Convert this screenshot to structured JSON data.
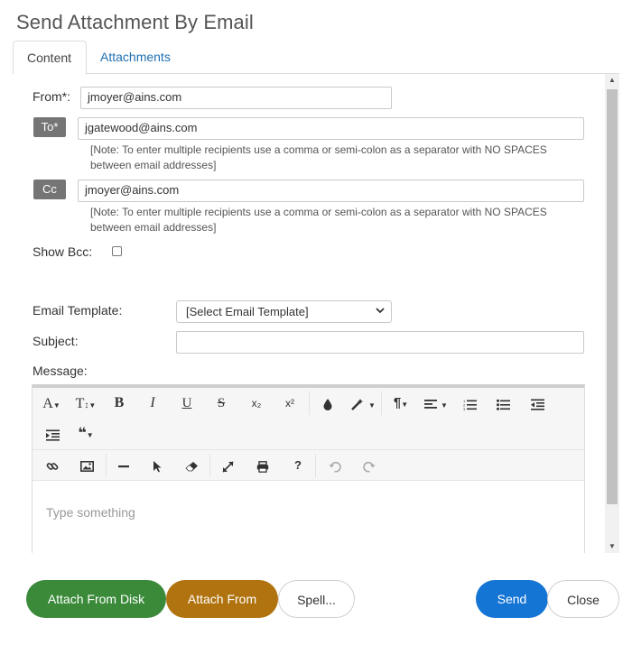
{
  "dialog": {
    "title": "Send Attachment By Email"
  },
  "tabs": [
    {
      "label": "Content"
    },
    {
      "label": "Attachments"
    }
  ],
  "form": {
    "from_label": "From*:",
    "from_value": "jmoyer@ains.com",
    "to_label": "To*",
    "to_value": "jgatewood@ains.com",
    "cc_label": "Cc",
    "cc_value": "jmoyer@ains.com",
    "note_text": "[Note: To enter multiple recipients use a comma or semi-colon as a separator with NO SPACES between email addresses]",
    "show_bcc_label": "Show Bcc:",
    "template_label": "Email Template:",
    "template_value": "[Select Email Template]",
    "subject_label": "Subject:",
    "subject_value": "",
    "message_label": "Message:"
  },
  "editor": {
    "placeholder": "Type something",
    "toolbar": {
      "font_size": "A",
      "line_height": "T",
      "bold": "B",
      "italic": "I",
      "underline": "U",
      "strike": "S",
      "subscript": "x₂",
      "superscript": "x²",
      "paragraph": "¶",
      "quote": "❝",
      "help": "?"
    }
  },
  "buttons": {
    "attach_disk": "Attach From Disk",
    "attach_from": "Attach From",
    "spell": "Spell...",
    "send": "Send",
    "close": "Close"
  },
  "colors": {
    "green": "#3a8a3a",
    "brown": "#b0730f",
    "blue": "#1475d4",
    "link": "#1f6fb0"
  }
}
